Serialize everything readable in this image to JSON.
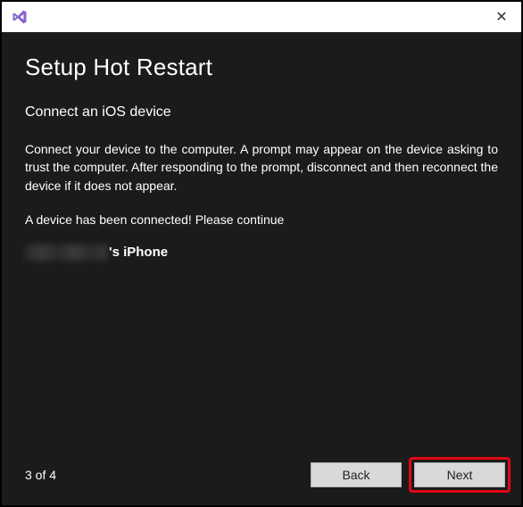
{
  "titlebar": {
    "logo_name": "visual-studio-logo",
    "close_symbol": "✕"
  },
  "wizard": {
    "title": "Setup Hot Restart",
    "subtitle": "Connect an iOS device",
    "instructions": "Connect your device to the computer. A prompt may appear on the device asking to trust the computer. After responding to the prompt, disconnect and then reconnect the device if it does not appear.",
    "status": "A device has been connected! Please continue",
    "device_suffix": "'s iPhone"
  },
  "footer": {
    "page_indicator": "3 of 4",
    "back_label": "Back",
    "next_label": "Next"
  }
}
